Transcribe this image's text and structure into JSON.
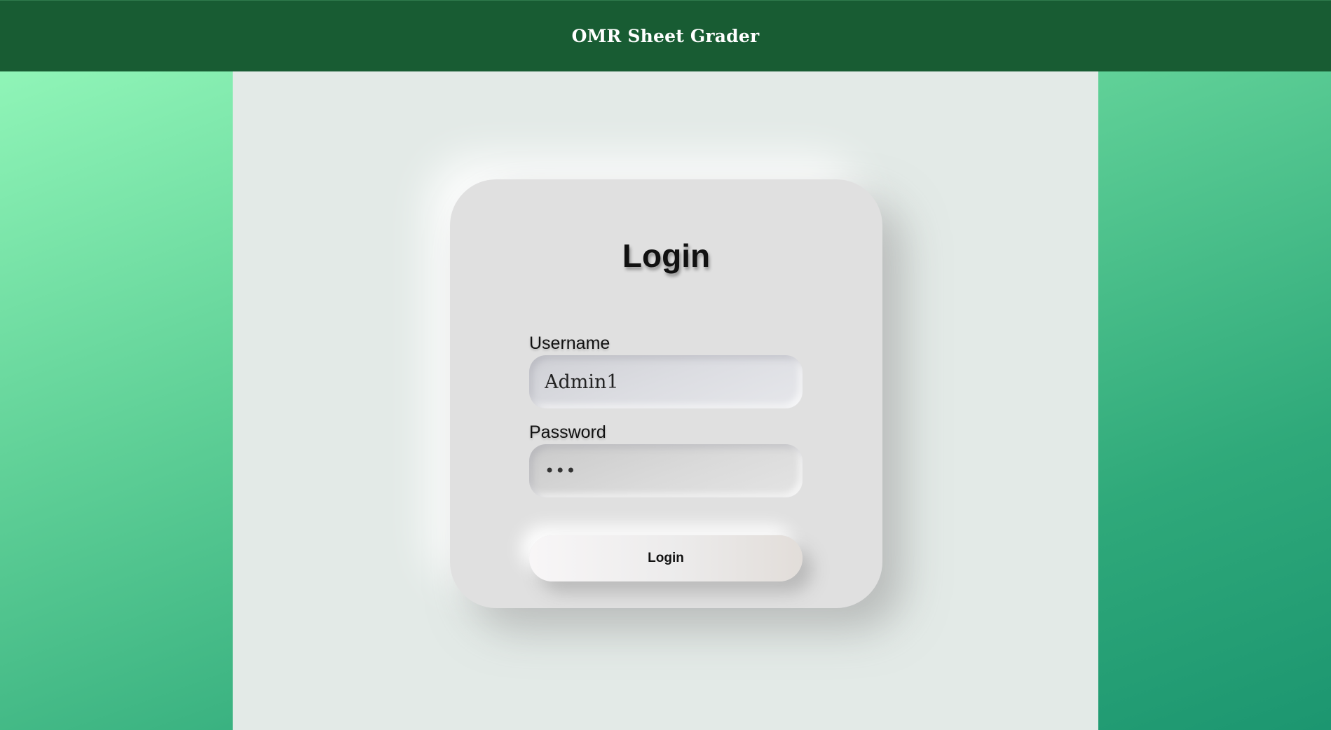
{
  "header": {
    "title": "OMR Sheet Grader"
  },
  "login": {
    "title": "Login",
    "username_label": "Username",
    "username_value": "Admin1",
    "password_label": "Password",
    "password_value": "abc",
    "button_label": "Login"
  },
  "colors": {
    "header_bg": "#185c33",
    "panel_bg": "#e3eae7",
    "card_bg": "#e0e0e0",
    "page_gradient_start": "#98fbbd",
    "page_gradient_end": "#1c9670"
  }
}
